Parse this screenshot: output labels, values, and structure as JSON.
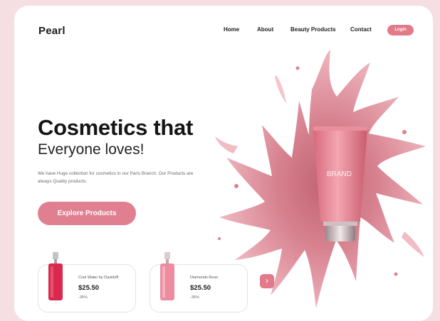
{
  "brand": {
    "name": "Pearl"
  },
  "nav": {
    "items": [
      "Home",
      "About",
      "Beauty Products",
      "Contact"
    ],
    "login_label": "Login"
  },
  "hero": {
    "title": "Cosmetics that",
    "subtitle": "Everyone loves!",
    "description": "We have Huge collection for cosmetics in our Paris Branch. Our Products are always Quality products.",
    "cta_label": "Explore Products",
    "product_brand": "BRAND"
  },
  "products": [
    {
      "name": "Cool Water by Davidoff",
      "price": "$25.50",
      "discount": "-35%"
    },
    {
      "name": "Diamonds Rose",
      "price": "$25.50",
      "discount": "-35%"
    }
  ],
  "next_icon": "chevron-right-icon",
  "colors": {
    "accent": "#e27a8a",
    "background": "#f6dfe2",
    "splash": "#d9808f"
  }
}
